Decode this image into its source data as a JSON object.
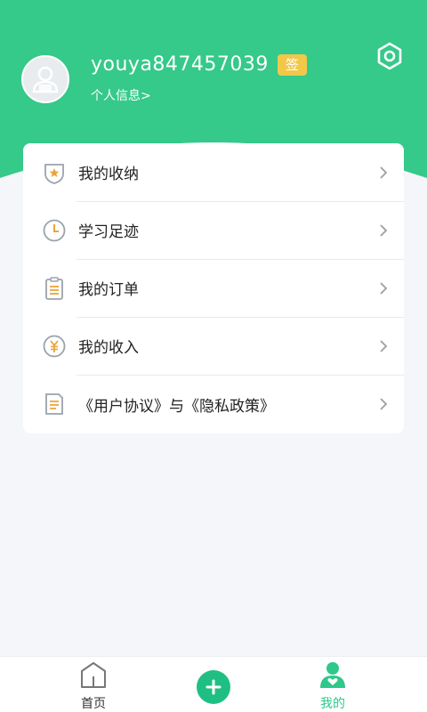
{
  "profile": {
    "username": "youya847457039",
    "sign_badge": "签",
    "info_link": "个人信息>"
  },
  "menu": {
    "items": [
      {
        "label": "我的收纳",
        "icon": "shield-star-icon"
      },
      {
        "label": "学习足迹",
        "icon": "clock-icon"
      },
      {
        "label": "我的订单",
        "icon": "clipboard-icon"
      },
      {
        "label": "我的收入",
        "icon": "yen-coin-icon"
      },
      {
        "label": "《用户协议》与《隐私政策》",
        "icon": "document-icon"
      }
    ]
  },
  "tabbar": {
    "home_label": "首页",
    "mine_label": "我的"
  },
  "colors": {
    "brand_green": "#35c98a",
    "badge_yellow": "#f2c84b",
    "icon_accent": "#e9a53a"
  }
}
